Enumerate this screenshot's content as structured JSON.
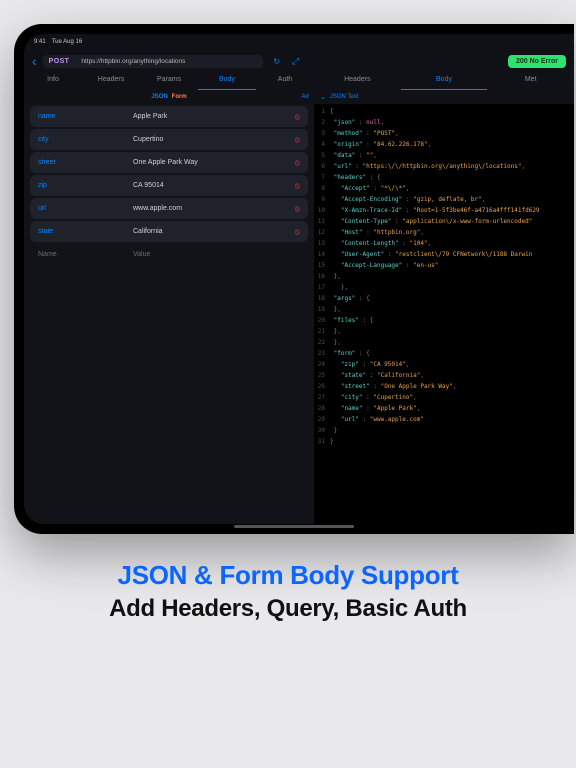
{
  "status": {
    "time": "9:41",
    "date": "Tue Aug 16"
  },
  "nav": {
    "method": "POST",
    "url": "https://httpbin.org/anything/locations"
  },
  "badge": "200 No Error",
  "reqTabs": [
    "Info",
    "Headers",
    "Params",
    "Body",
    "Auth"
  ],
  "reqActive": 3,
  "resTabs": [
    "Headers",
    "Body",
    "Met"
  ],
  "resActive": 1,
  "bodyMode": {
    "a": "JSON",
    "b": "Form",
    "add": "Ad"
  },
  "viewer": {
    "label": "JSON Text"
  },
  "rows": [
    {
      "key": "name",
      "val": "Apple Park"
    },
    {
      "key": "city",
      "val": "Cupertino"
    },
    {
      "key": "street",
      "val": "One Apple Park Way"
    },
    {
      "key": "zip",
      "val": "CA 95014"
    },
    {
      "key": "url",
      "val": "www.apple.com"
    },
    {
      "key": "state",
      "val": "California"
    }
  ],
  "ghost": {
    "key": "Name",
    "val": "Value"
  },
  "json": {
    "l1": "{",
    "l2k": "\"json\"",
    "l2v": "null",
    "l3k": "\"method\"",
    "l3v": "\"POST\"",
    "l4k": "\"origin\"",
    "l4v": "\"84.62.226.178\"",
    "l5k": "\"data\"",
    "l5v": "\"\"",
    "l6k": "\"url\"",
    "l6v": "\"https:\\/\\/httpbin.org\\/anything\\/locations\"",
    "l7k": "\"headers\"",
    "l8k": "\"Accept\"",
    "l8v": "\"*\\/\\*\"",
    "l9k": "\"Accept-Encoding\"",
    "l9v": "\"gzip, deflate, br\"",
    "l10k": "\"X-Amzn-Trace-Id\"",
    "l10v": "\"Root=1-5f3be46f-a4716a4fff141fd629",
    "l11k": "\"Content-Type\"",
    "l11v": "\"application\\/x-www-form-urlencoded\"",
    "l12k": "\"Host\"",
    "l12v": "\"httpbin.org\"",
    "l13k": "\"Content-Length\"",
    "l13v": "\"104\"",
    "l14k": "\"User-Agent\"",
    "l14v": "\"restclient\\/79 CFNetwork\\/1188 Darwin",
    "l15k": "\"Accept-Language\"",
    "l15v": "\"en-us\"",
    "l18k": "\"args\"",
    "l20k": "\"files\"",
    "l23k": "\"form\"",
    "l24k": "\"zip\"",
    "l24v": "\"CA 95014\"",
    "l25k": "\"state\"",
    "l25v": "\"California\"",
    "l26k": "\"street\"",
    "l26v": "\"One Apple Park Way\"",
    "l27k": "\"city\"",
    "l27v": "\"Cupertino\"",
    "l28k": "\"name\"",
    "l28v": "\"Apple Park\"",
    "l29k": "\"url\"",
    "l29v": "\"www.apple.com\""
  },
  "hero": {
    "title": "JSON & Form Body Support",
    "sub": "Add Headers, Query, Basic Auth"
  }
}
